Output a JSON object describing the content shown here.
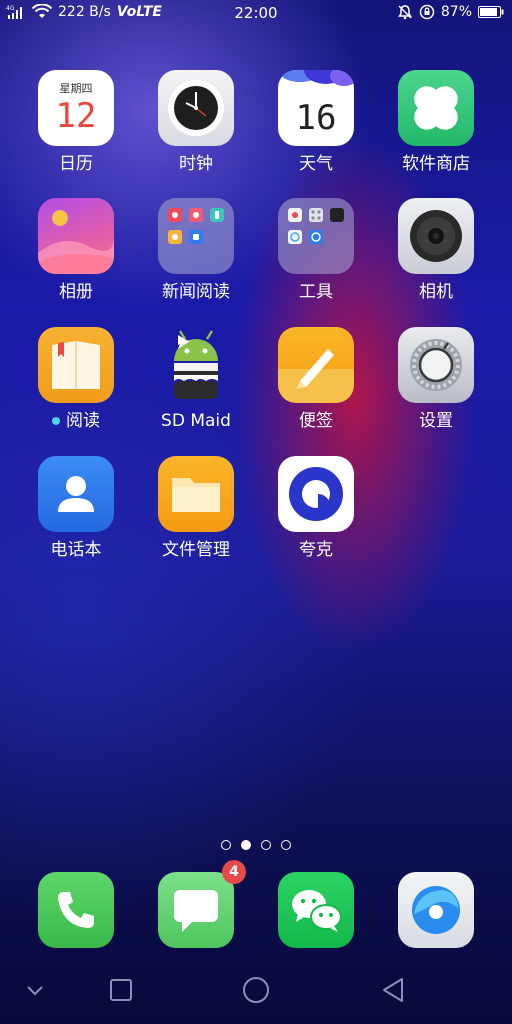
{
  "status_bar": {
    "network": "4G",
    "speed": "222 B/s",
    "volte": "VoLTE",
    "time": "22:00",
    "battery": "87%"
  },
  "apps": [
    {
      "label": "日历",
      "icon": "calendar-icon",
      "weekday": "星期四",
      "day": "12"
    },
    {
      "label": "时钟",
      "icon": "clock-icon"
    },
    {
      "label": "天气",
      "icon": "weather-icon",
      "day": "16"
    },
    {
      "label": "软件商店",
      "icon": "app-store-icon"
    },
    {
      "label": "相册",
      "icon": "gallery-icon"
    },
    {
      "label": "新闻阅读",
      "icon": "folder-icon"
    },
    {
      "label": "工具",
      "icon": "folder-icon"
    },
    {
      "label": "相机",
      "icon": "camera-icon"
    },
    {
      "label": "阅读",
      "icon": "book-icon"
    },
    {
      "label": "SD Maid",
      "icon": "android-maid-icon"
    },
    {
      "label": "便签",
      "icon": "notes-icon"
    },
    {
      "label": "设置",
      "icon": "settings-icon"
    },
    {
      "label": "电话本",
      "icon": "contacts-icon"
    },
    {
      "label": "文件管理",
      "icon": "file-manager-icon"
    },
    {
      "label": "夸克",
      "icon": "quark-browser-icon"
    }
  ],
  "page_indicator": {
    "count": 4,
    "active": 1
  },
  "dock": [
    {
      "icon": "phone-icon"
    },
    {
      "icon": "messages-icon",
      "badge": "4"
    },
    {
      "icon": "wechat-icon"
    },
    {
      "icon": "browser-icon"
    }
  ],
  "colors": {
    "calendar_red": "#e8473c",
    "appstore_green": "#2fc37b",
    "reader_orange": "#f5a623",
    "contacts_blue": "#2f7df0",
    "quark_blue": "#2a35c9",
    "badge_red": "#e84a4a"
  }
}
